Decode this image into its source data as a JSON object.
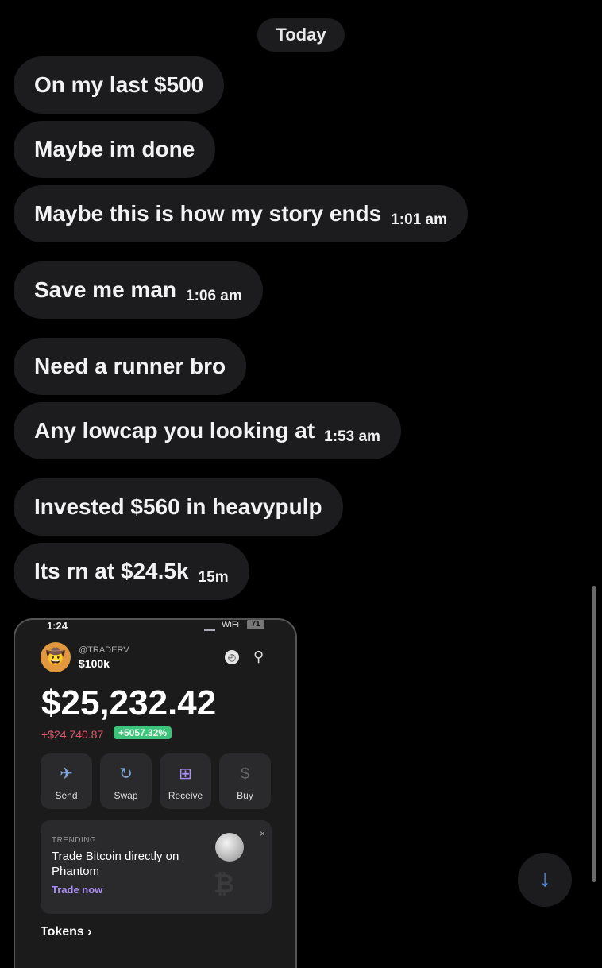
{
  "date_label": "Today",
  "messages": [
    {
      "text": "On my last $500",
      "time": ""
    },
    {
      "text": "Maybe im done",
      "time": ""
    },
    {
      "text": "Maybe this is how my story ends",
      "time": "1:01 am"
    },
    {
      "text": "Save me man",
      "time": "1:06 am"
    },
    {
      "text": "Need a runner bro",
      "time": ""
    },
    {
      "text": "Any lowcap you looking at",
      "time": "1:53 am"
    },
    {
      "text": "Invested $560 in heavypulp",
      "time": ""
    },
    {
      "text": "Its rn at $24.5k",
      "time": "15m"
    }
  ],
  "attachment": {
    "status_time": "1:24",
    "wifi_label": "WiFi",
    "battery": "71",
    "handle": "@TRADERV",
    "account_name": "$100k",
    "balance": "$25,232.42",
    "pnl": "+$24,740.87",
    "pnl_pct": "+5057.32%",
    "actions": [
      {
        "label": "Send",
        "icon": "✈"
      },
      {
        "label": "Swap",
        "icon": "↻"
      },
      {
        "label": "Receive",
        "icon": "⊞"
      },
      {
        "label": "Buy",
        "icon": "$"
      }
    ],
    "trending_label": "TRENDING",
    "promo_title": "Trade Bitcoin directly on Phantom",
    "promo_link": "Trade now",
    "close_icon": "×",
    "btc_glyph": "₿",
    "tokens_label": "Tokens ›"
  },
  "scroll_down_icon": "↓"
}
